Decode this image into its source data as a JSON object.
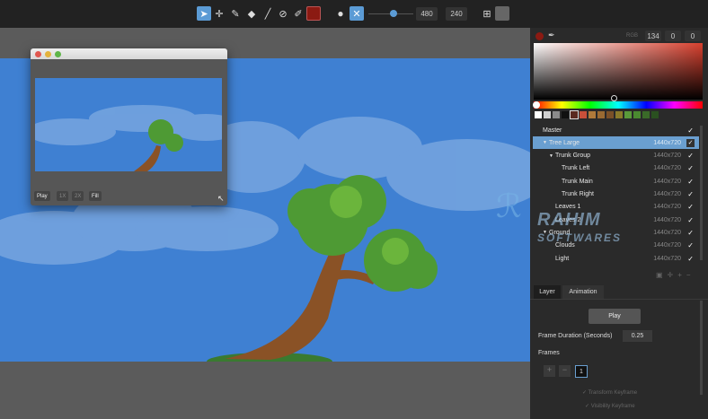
{
  "toolbar": {
    "tools": [
      "select-tool",
      "move-tool",
      "pencil-tool",
      "eraser-tool",
      "line-tool",
      "fill-tool",
      "brush-tool"
    ],
    "color": "#8b1a12",
    "width": "480",
    "height": "240"
  },
  "preview": {
    "play": "Play",
    "x1": "1X",
    "x2": "2X",
    "fill": "Fill"
  },
  "color_picker": {
    "mode": "RGB",
    "r": "134",
    "g": "0",
    "b": "0",
    "swatches": [
      "#ffffff",
      "#d0d0d0",
      "#8a8a8a",
      "#111111",
      "#5a2a20",
      "#c8503a",
      "#b07a3a",
      "#9a6a32",
      "#7a5028",
      "#8a7a2a",
      "#5a9a3a",
      "#4a8a30",
      "#3a6a28",
      "#2a5020"
    ]
  },
  "layers": [
    {
      "name": "Master",
      "size": "",
      "indent": 0,
      "selected": false
    },
    {
      "name": "Tree Large",
      "size": "1440x720",
      "indent": 1,
      "selected": true,
      "arrow": true
    },
    {
      "name": "Trunk Group",
      "size": "1440x720",
      "indent": 2,
      "selected": false,
      "arrow": true
    },
    {
      "name": "Trunk Left",
      "size": "1440x720",
      "indent": 3,
      "selected": false
    },
    {
      "name": "Trunk Main",
      "size": "1440x720",
      "indent": 3,
      "selected": false
    },
    {
      "name": "Trunk Right",
      "size": "1440x720",
      "indent": 3,
      "selected": false
    },
    {
      "name": "Leaves 1",
      "size": "1440x720",
      "indent": 2,
      "selected": false
    },
    {
      "name": "Leaves 2",
      "size": "1440x720",
      "indent": 2,
      "selected": false
    },
    {
      "name": "Ground",
      "size": "1440x720",
      "indent": 1,
      "selected": false,
      "arrow": true
    },
    {
      "name": "Clouds",
      "size": "1440x720",
      "indent": 2,
      "selected": false
    },
    {
      "name": "Light",
      "size": "1440x720",
      "indent": 2,
      "selected": false
    }
  ],
  "tabs": {
    "layer": "Layer",
    "animation": "Animation"
  },
  "animation": {
    "play": "Play",
    "frame_duration_label": "Frame Duration (Seconds)",
    "frame_duration": "0.25",
    "frames_label": "Frames",
    "frame": "1",
    "transform_keyframe": "Transform Keyframe",
    "visibility_keyframe": "Visibility Keyframe"
  },
  "watermark": "RAHIM SOFTWARES"
}
